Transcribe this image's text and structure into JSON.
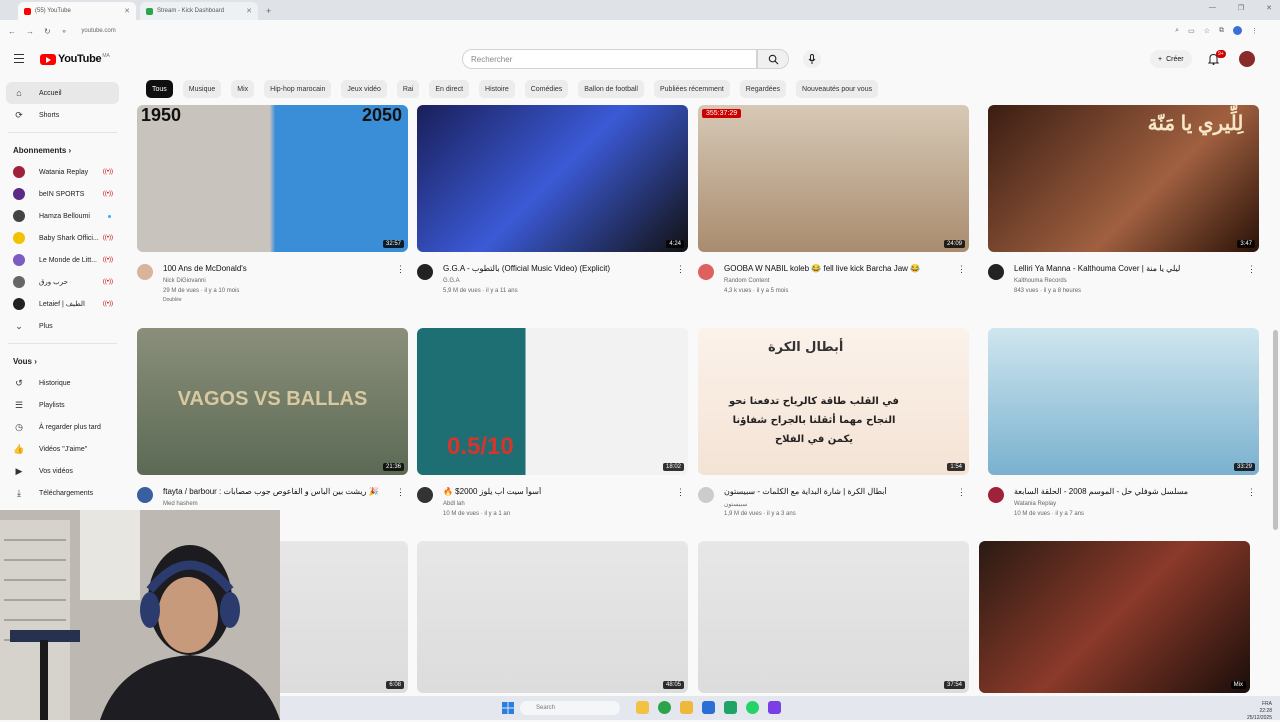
{
  "browser": {
    "tabs": [
      {
        "label": "(55) YouTube",
        "color": "#ff0000"
      },
      {
        "label": "Stream - Kick Dashboard",
        "color": "#2aa54a"
      }
    ],
    "new_tab": "+",
    "url": "youtube.com",
    "win_min": "—",
    "win_max": "❐",
    "win_close": "✕"
  },
  "header": {
    "logo_text": "YouTube",
    "country": "MA",
    "search_placeholder": "Rechercher",
    "create_label": "Créer",
    "notif_count": "9+"
  },
  "chips": [
    "Tous",
    "Musique",
    "Mix",
    "Hip-hop marocain",
    "Jeux vidéo",
    "Rai",
    "En direct",
    "Histoire",
    "Comédies",
    "Ballon de football",
    "Publiées récemment",
    "Regardées",
    "Nouveautés pour vous"
  ],
  "sidebar": {
    "main": [
      {
        "label": "Accueil",
        "icon": "home-icon",
        "glyph": "⌂"
      },
      {
        "label": "Shorts",
        "icon": "shorts-icon",
        "glyph": "⟳"
      }
    ],
    "subs_heading": "Abonnements  ›",
    "subscriptions": [
      {
        "label": "Watania Replay",
        "color": "#a0223a",
        "status": "live"
      },
      {
        "label": "beIN SPORTS",
        "color": "#5b2a86",
        "status": "live"
      },
      {
        "label": "Hamza Belloumi",
        "color": "#444444",
        "status": "dot"
      },
      {
        "label": "Baby Shark Offici...",
        "color": "#f2c200",
        "status": "live"
      },
      {
        "label": "Le Monde de Litt...",
        "color": "#7a5cc2",
        "status": "live"
      },
      {
        "label": "حرب ورق",
        "color": "#666666",
        "status": "live"
      },
      {
        "label": "Letaief | الطيف",
        "color": "#222222",
        "status": "live"
      }
    ],
    "more_label": "Plus",
    "more_glyph": "⌄",
    "you_heading": "Vous  ›",
    "you_items": [
      {
        "label": "Historique",
        "icon": "history-icon",
        "glyph": "↺"
      },
      {
        "label": "Playlists",
        "icon": "playlist-icon",
        "glyph": "☰"
      },
      {
        "label": "À regarder plus tard",
        "icon": "watch-later-icon",
        "glyph": "◷"
      },
      {
        "label": "Vidéos \"J'aime\"",
        "icon": "like-icon",
        "glyph": "👍"
      },
      {
        "label": "Vos vidéos",
        "icon": "your-videos-icon",
        "glyph": "▶"
      },
      {
        "label": "Téléchargements",
        "icon": "download-icon",
        "glyph": "⤓"
      }
    ]
  },
  "videos": [
    {
      "title": "100 Ans de McDonald's",
      "channel": "Nick DiGiovanni",
      "meta": "29 M de vues · il y a 10 mois",
      "extra": "Doublée",
      "duration": "32:57",
      "avatar": "#d8b49a",
      "thumb_text_left": "1950",
      "thumb_text_right": "2050"
    },
    {
      "title": "G.G.A - بالتطوب (Official Music Video) (Explicit)",
      "channel": "G.G.A",
      "meta": "5,9 M de vues · il y a 11 ans",
      "duration": "4:24",
      "avatar": "#222222"
    },
    {
      "title": "GOOBA W NABIL koleb 😂 fell live kick Barcha Jaw 😂",
      "channel": "Random Content",
      "meta": "4,3 k vues · il y a 5 mois",
      "duration": "24:09",
      "live_duration": "355:37:29",
      "avatar": "#e06060"
    },
    {
      "title": "Lelliri Ya Manna - Kalthouma Cover | ليلي يا منة",
      "channel": "Kalthouma Records",
      "meta": "843 vues · il y a 8 heures",
      "duration": "3:47",
      "avatar": "#222222",
      "thumb_text": "لِلِّيري يا مَنّة"
    },
    {
      "title": "ftayta / barbour : ريشت بين الباس و الفاعوص جوب صصابات 🎉",
      "channel": "Med hashem",
      "meta": "",
      "duration": "21:36",
      "avatar": "#3a5fa0",
      "thumb_text": "VAGOS VS BALLAS"
    },
    {
      "title": "🔥 $2000 أسوأ سيت آب يلوز",
      "channel": "Abdl lah",
      "meta": "10 M de vues · il y a 1 an",
      "duration": "18:02",
      "avatar": "#333333",
      "thumb_text": "0.5/10"
    },
    {
      "title": "أبطال الكرة | شارة البداية مع الكلمات - سبيستون",
      "channel": "سبيستون",
      "meta": "1,9 M de vues · il y a 3 ans",
      "duration": "1:54",
      "avatar": "#cccccc",
      "thumb_title": "أبطال الكرة",
      "thumb_lines": [
        "في القلب طاقة كالرياح تدفعنا نحو",
        "النجاح مهما أثقلنا بالجراح شفاؤنا",
        "يكمن في الفلاح"
      ]
    },
    {
      "title": "مسلسل شوفلي حل - الموسم 2008 - الحلقة السابعة",
      "channel": "Watania Replay",
      "meta": "10 M de vues · il y a 7 ans",
      "duration": "33:29",
      "avatar": "#a0223a"
    },
    {
      "duration": "6:08"
    },
    {
      "duration": "48:05"
    },
    {
      "duration": "37:54"
    },
    {
      "duration": "Mix"
    }
  ],
  "taskbar": {
    "search": "Search",
    "lang": "FRA",
    "clock": "22:28",
    "date": "25/12/2025"
  },
  "colors": {
    "accent": "#ff0000",
    "bg": "#f9f9f9"
  }
}
